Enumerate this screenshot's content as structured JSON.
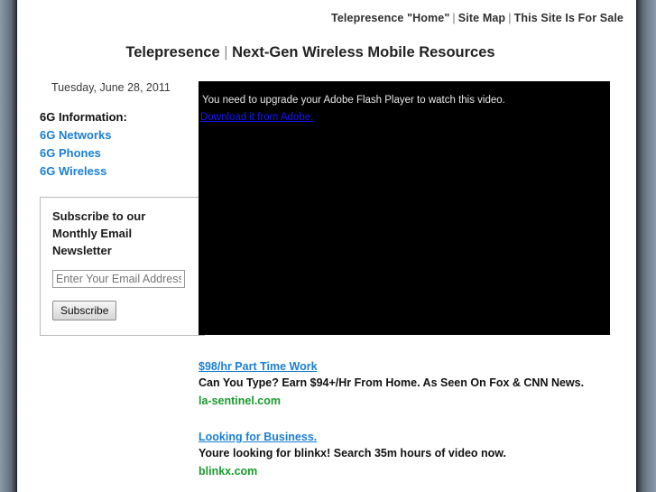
{
  "topnav": {
    "items": [
      {
        "label": "Telepresence \"Home\""
      },
      {
        "label": "Site Map"
      },
      {
        "label": "This Site Is For Sale"
      }
    ],
    "separator": "|"
  },
  "header": {
    "title_main": "Telepresence",
    "title_sep": "|",
    "title_sub": "Next-Gen Wireless Mobile Resources"
  },
  "sidebar": {
    "date": "Tuesday, June 28, 2011",
    "list_heading": "6G Information:",
    "links": [
      {
        "label": "6G Networks"
      },
      {
        "label": "6G Phones"
      },
      {
        "label": "6G Wireless"
      }
    ],
    "subscribe": {
      "title": "Subscribe to our Monthly Email Newsletter",
      "email_placeholder": "Enter Your Email Address",
      "button_label": "Subscribe"
    }
  },
  "video": {
    "message": "You need to upgrade your Adobe Flash Player to watch this video.",
    "download_link": "Download it from Adobe."
  },
  "ads": [
    {
      "title": "$98/hr Part Time Work",
      "description": "Can You Type? Earn $94+/Hr From Home. As Seen On Fox & CNN News.",
      "url": "la-sentinel.com"
    },
    {
      "title": "Looking for Business.",
      "description": "Youre looking for blinkx! Search 35m hours of video now.",
      "url": "blinkx.com"
    }
  ],
  "colors": {
    "link_blue": "#1a7fd4",
    "ad_url_green": "#1a9a2e",
    "flash_link_blue": "#1414ff",
    "nav_text": "#2f2f2f"
  }
}
